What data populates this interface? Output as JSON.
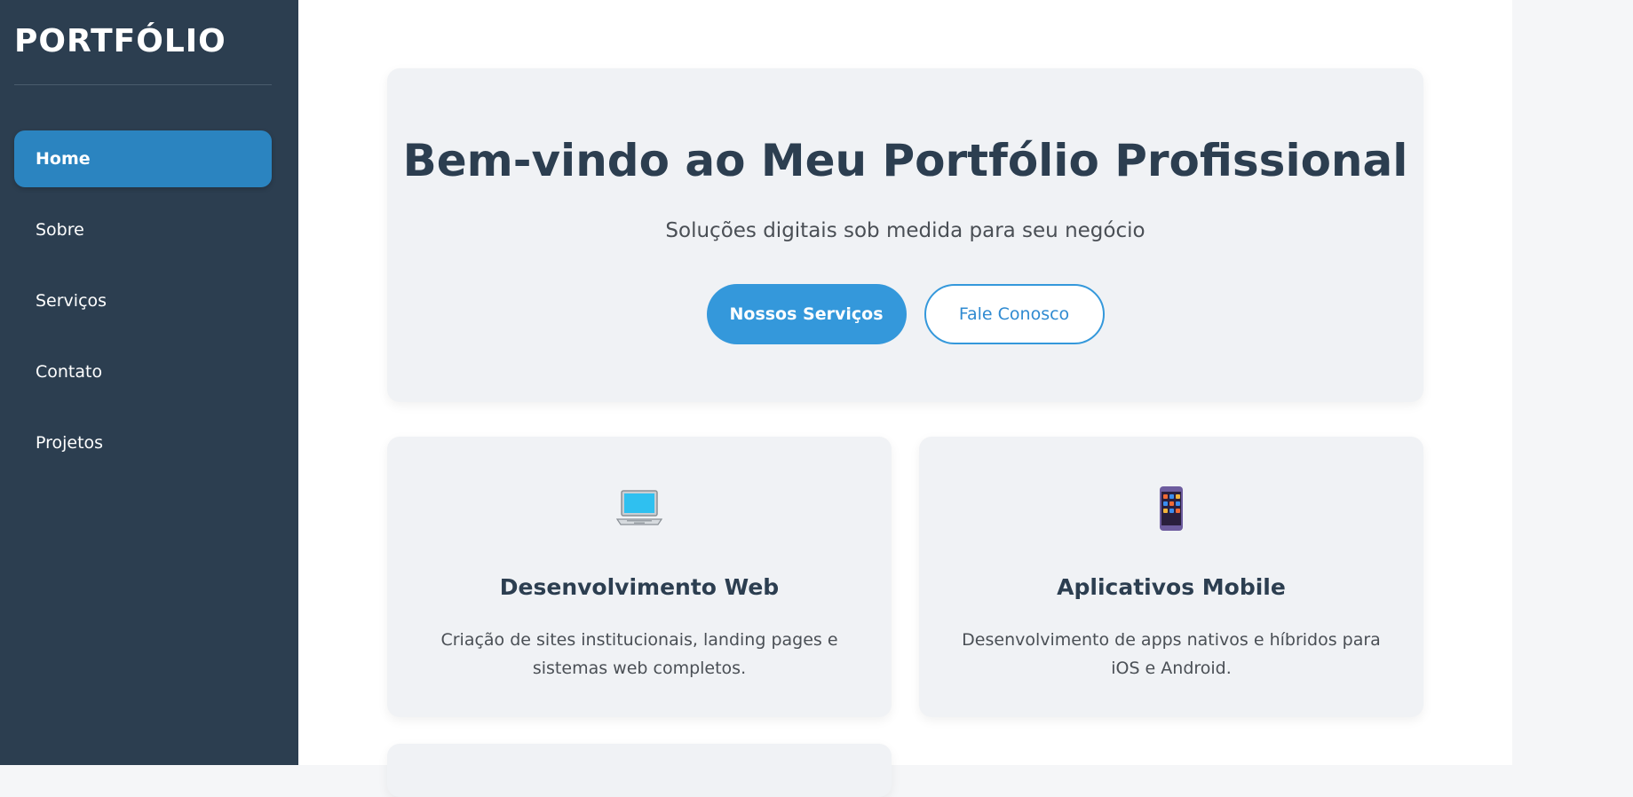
{
  "sidebar": {
    "brand": "PORTFÓLIO",
    "items": [
      {
        "label": "Home",
        "active": true
      },
      {
        "label": "Sobre"
      },
      {
        "label": "Serviços"
      },
      {
        "label": "Contato"
      },
      {
        "label": "Projetos"
      }
    ]
  },
  "hero": {
    "title": "Bem-vindo ao Meu Portfólio Profissional",
    "subtitle": "Soluções digitais sob medida para seu negócio",
    "primary_button": "Nossos Serviços",
    "secondary_button": "Fale Conosco"
  },
  "services": [
    {
      "icon": "laptop-icon",
      "title": "Desenvolvimento Web",
      "text": "Criação de sites institucionais, landing pages e sistemas web completos."
    },
    {
      "icon": "mobile-phone-icon",
      "title": "Aplicativos Mobile",
      "text": "Desenvolvimento de apps nativos e híbridos para iOS e Android."
    }
  ],
  "colors": {
    "sidebar_bg": "#2c3e50",
    "accent": "#3498db",
    "active_nav": "#2b84c0",
    "card_bg": "#f0f2f5",
    "heading": "#2c3e50"
  }
}
